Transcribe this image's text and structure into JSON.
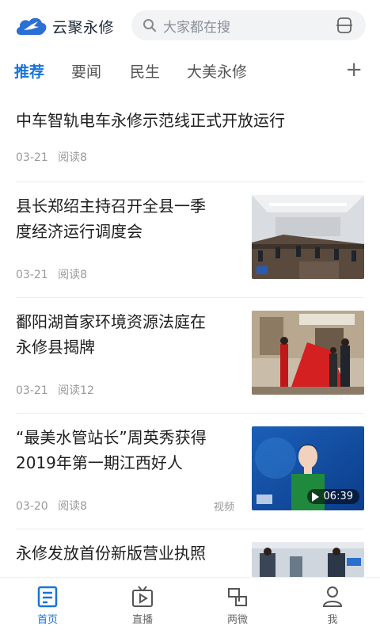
{
  "header": {
    "app_name": "云聚永修",
    "search_placeholder": "大家都在搜",
    "logo_icon": "cloud-bird-logo",
    "accent_color": "#1a73d9"
  },
  "tabs": [
    {
      "label": "推荐",
      "active": true
    },
    {
      "label": "要闻",
      "active": false
    },
    {
      "label": "民生",
      "active": false
    },
    {
      "label": "大美永修",
      "active": false
    }
  ],
  "feed": [
    {
      "title_lines": [
        "中车智轨电车永修示范线正式开放运行"
      ],
      "date": "03-21",
      "reads": "阅读8"
    },
    {
      "title_lines": [
        "县长郑绍主持召开全县一季",
        "度经济运行调度会"
      ],
      "date": "03-21",
      "reads": "阅读8"
    },
    {
      "title_lines": [
        "鄱阳湖首家环境资源法庭在",
        "永修县揭牌"
      ],
      "date": "03-21",
      "reads": "阅读12"
    },
    {
      "title_lines": [
        "“最美水管站长”周英秀获得",
        "2019年第一期江西好人"
      ],
      "date": "03-20",
      "reads": "阅读8",
      "tag": "视频",
      "duration": "06:39"
    },
    {
      "title_lines": [
        "永修发放首份新版营业执照"
      ]
    }
  ],
  "bottom_nav": [
    {
      "label": "首页",
      "icon": "home-icon",
      "active": true
    },
    {
      "label": "直播",
      "icon": "live-tv-icon",
      "active": false
    },
    {
      "label": "两微",
      "icon": "two-squares-icon",
      "active": false
    },
    {
      "label": "我",
      "icon": "user-icon",
      "active": false
    }
  ]
}
